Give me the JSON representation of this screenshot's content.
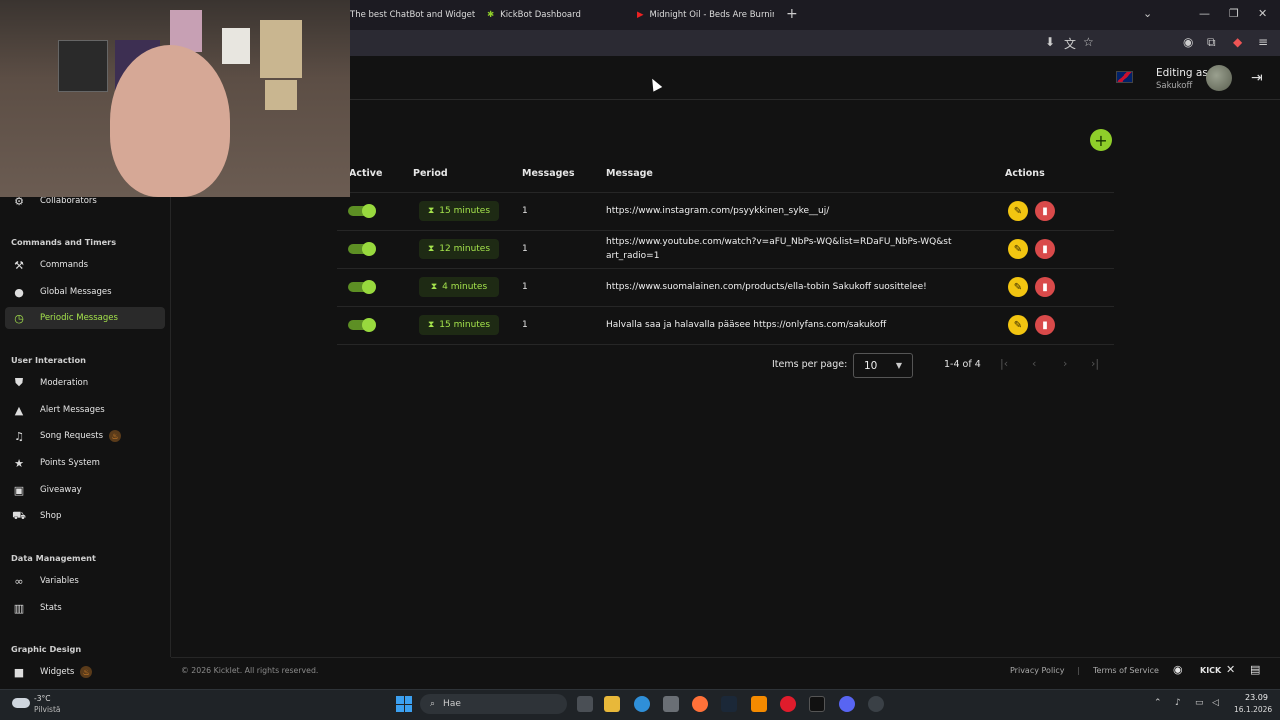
{
  "browser": {
    "tabs": [
      {
        "label": "The best ChatBot and Widgets |"
      },
      {
        "label": "KickBot Dashboard"
      },
      {
        "label": "Midnight Oil - Beds Are Burnin"
      }
    ],
    "new_tab": "+",
    "close": "✕"
  },
  "header": {
    "editing_as": "Editing as",
    "user": "Sakukoff"
  },
  "sidebar": {
    "top_item": "Collaborators",
    "sections": [
      {
        "title": "Commands and Timers",
        "items": [
          {
            "label": "Commands",
            "icon": "hammer-icon"
          },
          {
            "label": "Global Messages",
            "icon": "chat-icon"
          },
          {
            "label": "Periodic Messages",
            "icon": "clock-icon",
            "active": true
          }
        ]
      },
      {
        "title": "User Interaction",
        "items": [
          {
            "label": "Moderation",
            "icon": "shield-icon"
          },
          {
            "label": "Alert Messages",
            "icon": "warning-icon"
          },
          {
            "label": "Song Requests",
            "icon": "music-icon",
            "badge": "fire"
          },
          {
            "label": "Points System",
            "icon": "star-icon"
          },
          {
            "label": "Giveaway",
            "icon": "gift-icon"
          },
          {
            "label": "Shop",
            "icon": "cart-icon"
          }
        ]
      },
      {
        "title": "Data Management",
        "items": [
          {
            "label": "Variables",
            "icon": "link-icon"
          },
          {
            "label": "Stats",
            "icon": "bar-chart-icon"
          }
        ]
      },
      {
        "title": "Graphic Design",
        "items": [
          {
            "label": "Widgets",
            "icon": "video-icon",
            "badge": "fire"
          }
        ]
      }
    ]
  },
  "table": {
    "headers": {
      "active": "Active",
      "period": "Period",
      "messages": "Messages",
      "message": "Message",
      "actions": "Actions"
    },
    "rows": [
      {
        "active": true,
        "period": "15 minutes",
        "count": "1",
        "message": "https://www.instagram.com/psyykkinen_syke__uj/"
      },
      {
        "active": true,
        "period": "12 minutes",
        "count": "1",
        "message": "https://www.youtube.com/watch?v=aFU_NbPs-WQ&list=RDaFU_NbPs-WQ&start_radio=1"
      },
      {
        "active": true,
        "period": "4 minutes",
        "count": "1",
        "message": "https://www.suomalainen.com/products/ella-tobin Sakukoff suosittelee!"
      },
      {
        "active": true,
        "period": "15 minutes",
        "count": "1",
        "message": "Halvalla saa ja halavalla pääsee https://onlyfans.com/sakukoff"
      }
    ]
  },
  "pagination": {
    "items_per_page_label": "Items per page:",
    "items_per_page": "10",
    "range": "1-4 of 4"
  },
  "footer": {
    "copyright": "© 2026 Kicklet. All rights reserved.",
    "privacy": "Privacy Policy",
    "separator": "|",
    "terms": "Terms of Service",
    "kick": "KICK"
  },
  "taskbar": {
    "temp": "-3°C",
    "weather": "Pilvistä",
    "search": "Hae",
    "time": "23.09",
    "date": "16.1.2026"
  },
  "colors": {
    "accent": "#a4e24c",
    "edit": "#f2c511",
    "delete": "#d94a4a"
  }
}
